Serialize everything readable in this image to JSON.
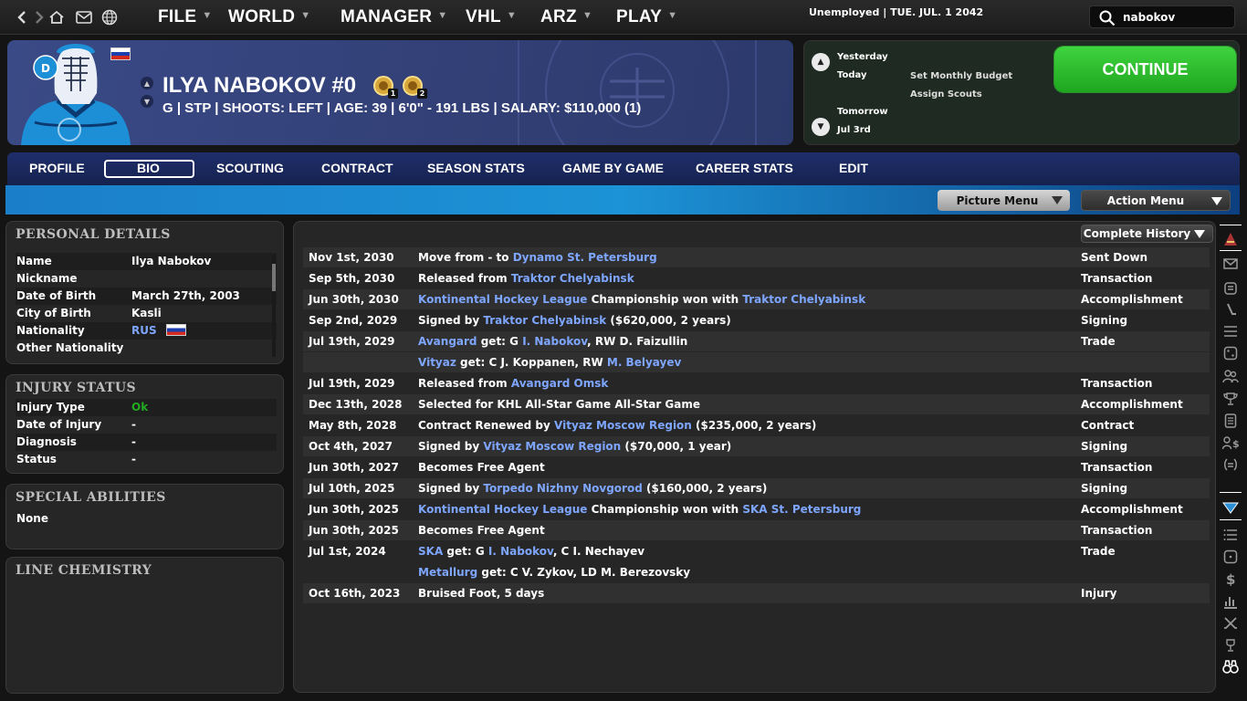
{
  "nav": {
    "menus": [
      {
        "label": "FILE"
      },
      {
        "label": "WORLD"
      },
      {
        "label": "MANAGER"
      },
      {
        "label": "VHL"
      },
      {
        "label": "ARZ"
      },
      {
        "label": "PLAY"
      }
    ],
    "status": "Unemployed | TUE. JUL. 1 2042",
    "search_value": "nabokov"
  },
  "player": {
    "name": "ILYA NABOKOV #0",
    "info": "G | STP | SHOOTS: LEFT | AGE: 39 | 6'0\" - 191 LBS | SALARY: $110,000 (1)",
    "badge_1": "1",
    "badge_2": "2"
  },
  "calendar": {
    "yesterday": "Yesterday",
    "today": "Today",
    "tomorrow": "Tomorrow",
    "next_date": "Jul 3rd",
    "tasks": [
      "Set Monthly Budget",
      "Assign Scouts"
    ],
    "continue_label": "CONTINUE"
  },
  "tabs": [
    "PROFILE",
    "BIO",
    "SCOUTING",
    "CONTRACT",
    "SEASON STATS",
    "GAME BY GAME",
    "CAREER STATS",
    "EDIT"
  ],
  "active_tab": "BIO",
  "subbar": {
    "picture_menu": "Picture Menu",
    "action_menu": "Action Menu"
  },
  "personal_details": {
    "title": "PERSONAL DETAILS",
    "rows": [
      {
        "label": "Name",
        "value": "Ilya Nabokov"
      },
      {
        "label": "Nickname",
        "value": ""
      },
      {
        "label": "Date of Birth",
        "value": "March 27th, 2003"
      },
      {
        "label": "City of Birth",
        "value": "Kasli"
      },
      {
        "label": "Nationality",
        "value": "RUS"
      },
      {
        "label": "Other Nationality",
        "value": ""
      }
    ]
  },
  "injury_status": {
    "title": "INJURY STATUS",
    "rows": [
      {
        "label": "Injury Type",
        "value": "Ok"
      },
      {
        "label": "Date of Injury",
        "value": "-"
      },
      {
        "label": "Diagnosis",
        "value": "-"
      },
      {
        "label": "Status",
        "value": "-"
      }
    ]
  },
  "special_abilities": {
    "title": "SPECIAL ABILITIES",
    "value": "None"
  },
  "line_chemistry": {
    "title": "LINE CHEMISTRY"
  },
  "history": {
    "filter": "Complete History",
    "rows": [
      {
        "date": "Nov 1st, 2030",
        "type": "Sent Down",
        "segs": [
          [
            "Move from - to ",
            0
          ],
          [
            "Dynamo St. Petersburg",
            1
          ]
        ]
      },
      {
        "date": "Sep 5th, 2030",
        "type": "Transaction",
        "segs": [
          [
            "Released from ",
            0
          ],
          [
            "Traktor Chelyabinsk",
            1
          ]
        ]
      },
      {
        "date": "Jun 30th, 2030",
        "type": "Accomplishment",
        "segs": [
          [
            "Kontinental Hockey League",
            1
          ],
          [
            " Championship won with ",
            0
          ],
          [
            "Traktor Chelyabinsk",
            1
          ]
        ]
      },
      {
        "date": "Sep 2nd, 2029",
        "type": "Signing",
        "segs": [
          [
            "Signed by ",
            0
          ],
          [
            "Traktor Chelyabinsk",
            1
          ],
          [
            " ($620,000, 2 years)",
            0
          ]
        ]
      },
      {
        "date": "Jul 19th, 2029",
        "type": "Trade",
        "segs": [
          [
            "Avangard",
            1
          ],
          [
            " get: G ",
            0
          ],
          [
            "I. Nabokov",
            1
          ],
          [
            ", RW D. Faizullin",
            0
          ]
        ]
      },
      {
        "date": "",
        "type": "",
        "segs": [
          [
            "Vityaz",
            1
          ],
          [
            " get: C J. Koppanen, RW ",
            0
          ],
          [
            "M. Belyayev",
            1
          ]
        ]
      },
      {
        "date": "Jul 19th, 2029",
        "type": "Transaction",
        "segs": [
          [
            "Released from ",
            0
          ],
          [
            "Avangard Omsk",
            1
          ]
        ]
      },
      {
        "date": "Dec 13th, 2028",
        "type": "Accomplishment",
        "segs": [
          [
            "Selected for KHL All-Star Game All-Star Game",
            0
          ]
        ]
      },
      {
        "date": "May 8th, 2028",
        "type": "Contract",
        "segs": [
          [
            "Contract Renewed by ",
            0
          ],
          [
            "Vityaz Moscow Region",
            1
          ],
          [
            " ($235,000, 2 years)",
            0
          ]
        ]
      },
      {
        "date": "Oct 4th, 2027",
        "type": "Signing",
        "segs": [
          [
            "Signed by ",
            0
          ],
          [
            "Vityaz Moscow Region",
            1
          ],
          [
            " ($70,000, 1 year)",
            0
          ]
        ]
      },
      {
        "date": "Jun 30th, 2027",
        "type": "Transaction",
        "segs": [
          [
            "Becomes Free Agent",
            0
          ]
        ]
      },
      {
        "date": "Jul 10th, 2025",
        "type": "Signing",
        "segs": [
          [
            "Signed by ",
            0
          ],
          [
            "Torpedo Nizhny Novgorod",
            1
          ],
          [
            " ($160,000, 2 years)",
            0
          ]
        ]
      },
      {
        "date": "Jun 30th, 2025",
        "type": "Accomplishment",
        "segs": [
          [
            "Kontinental Hockey League",
            1
          ],
          [
            " Championship won with ",
            0
          ],
          [
            "SKA St. Petersburg",
            1
          ]
        ]
      },
      {
        "date": "Jun 30th, 2025",
        "type": "Transaction",
        "segs": [
          [
            "Becomes Free Agent",
            0
          ]
        ]
      },
      {
        "date": "Jul 1st, 2024",
        "type": "Trade",
        "segs": [
          [
            "SKA",
            1
          ],
          [
            " get: G ",
            0
          ],
          [
            "I. Nabokov",
            1
          ],
          [
            ", C I. Nechayev",
            0
          ]
        ]
      },
      {
        "date": "",
        "type": "",
        "segs": [
          [
            "Metallurg",
            1
          ],
          [
            " get: C V. Zykov, LD M. Berezovsky",
            0
          ]
        ]
      },
      {
        "date": "Oct 16th, 2023",
        "type": "Injury",
        "segs": [
          [
            "Bruised Foot, 5 days",
            0
          ]
        ]
      }
    ]
  },
  "colors": {
    "link": "#7ea6ff",
    "ok_green": "#22aa22",
    "continue_green": "#2fc02f",
    "header_blue": "#34427a"
  }
}
